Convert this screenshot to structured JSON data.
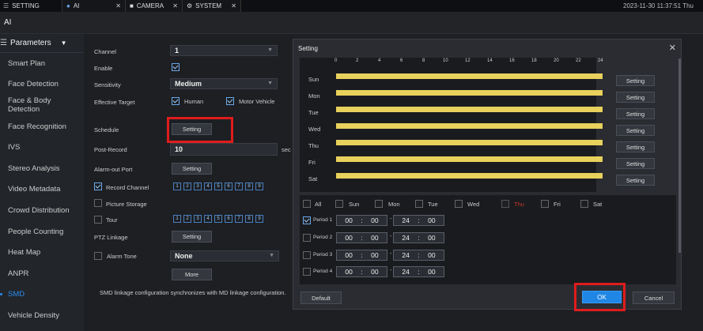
{
  "topbar": {
    "setting_label": "SETTING",
    "tabs": [
      {
        "label": "AI",
        "close": "✕"
      },
      {
        "label": "CAMERA",
        "close": "✕"
      },
      {
        "label": "SYSTEM",
        "close": "✕"
      }
    ],
    "datetime": "2023-11-30 11:37:51 Thu"
  },
  "title": "AI",
  "sidebar": {
    "header": "Parameters",
    "items": [
      "Smart Plan",
      "Face Detection",
      "Face & Body Detection",
      "Face Recognition",
      "IVS",
      "Stereo Analysis",
      "Video Metadata",
      "Crowd Distribution",
      "People Counting",
      "Heat Map",
      "ANPR",
      "SMD",
      "Vehicle Density"
    ],
    "active_item": "SMD"
  },
  "form": {
    "channel_label": "Channel",
    "channel_value": "1",
    "enable_label": "Enable",
    "sensitivity_label": "Sensitivity",
    "sensitivity_value": "Medium",
    "effective_target_label": "Effective Target",
    "target_human": "Human",
    "target_motor": "Motor Vehicle",
    "schedule_label": "Schedule",
    "schedule_button": "Setting",
    "post_record_label": "Post-Record",
    "post_record_value": "10",
    "post_record_unit": "sec",
    "alarm_out_label": "Alarm-out Port",
    "alarm_out_button": "Setting",
    "record_channel_label": "Record Channel",
    "record_channel_nums": [
      "1",
      "2",
      "3",
      "4",
      "5",
      "6",
      "7",
      "8",
      "9"
    ],
    "picture_storage_label": "Picture Storage",
    "tour_label": "Tour",
    "tour_nums": [
      "1",
      "2",
      "3",
      "4",
      "5",
      "6",
      "7",
      "8",
      "9"
    ],
    "ptz_label": "PTZ Linkage",
    "ptz_button": "Setting",
    "alarm_tone_label": "Alarm Tone",
    "alarm_tone_value": "None",
    "more_button": "More",
    "note": "SMD linkage configuration synchronizes with MD linkage configuration."
  },
  "dialog": {
    "title": "Setting",
    "close": "✕",
    "hours": [
      "0",
      "2",
      "4",
      "6",
      "8",
      "10",
      "12",
      "14",
      "16",
      "18",
      "20",
      "22",
      "24"
    ],
    "days": [
      "Sun",
      "Mon",
      "Tue",
      "Wed",
      "Thu",
      "Fri",
      "Sat"
    ],
    "day_button": "Setting",
    "check_labels": [
      "All",
      "Sun",
      "Mon",
      "Tue",
      "Wed",
      "Thu",
      "Fri",
      "Sat"
    ],
    "periods": [
      {
        "label": "Period 1",
        "start_h": "00",
        "start_m": "00",
        "end_h": "24",
        "end_m": "00"
      },
      {
        "label": "Period 2",
        "start_h": "00",
        "start_m": "00",
        "end_h": "24",
        "end_m": "00"
      },
      {
        "label": "Period 3",
        "start_h": "00",
        "start_m": "00",
        "end_h": "24",
        "end_m": "00"
      },
      {
        "label": "Period 4",
        "start_h": "00",
        "start_m": "00",
        "end_h": "24",
        "end_m": "00"
      }
    ],
    "default_button": "Default",
    "ok_button": "OK",
    "cancel_button": "Cancel"
  },
  "colors": {
    "accent": "#2b8df0",
    "schedule_bar": "#e8d15c",
    "highlight": "#e01c1c",
    "ok": "#1f86e5"
  }
}
